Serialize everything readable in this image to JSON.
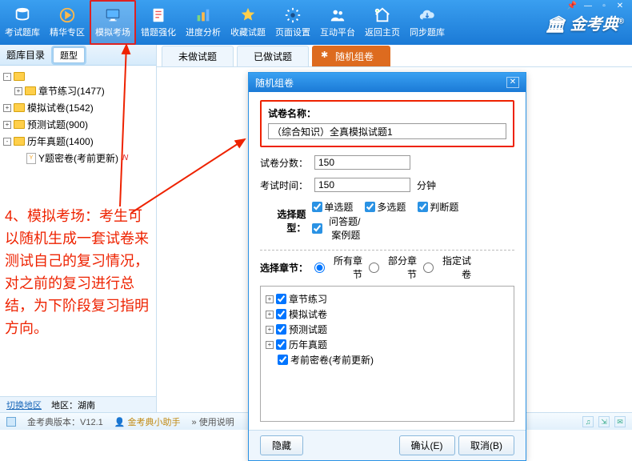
{
  "toolbar": {
    "items": [
      {
        "label": "考试题库",
        "name": "exam-bank",
        "icon": "db"
      },
      {
        "label": "精华专区",
        "name": "highlights",
        "icon": "play"
      },
      {
        "label": "模拟考场",
        "name": "mock-exam",
        "icon": "monitor",
        "selected": true
      },
      {
        "label": "错题强化",
        "name": "wrong-q",
        "icon": "sheet"
      },
      {
        "label": "进度分析",
        "name": "progress",
        "icon": "chart"
      },
      {
        "label": "收藏试题",
        "name": "favorites",
        "icon": "star"
      },
      {
        "label": "页面设置",
        "name": "page-setup",
        "icon": "gear"
      },
      {
        "label": "互动平台",
        "name": "community",
        "icon": "people"
      },
      {
        "label": "返回主页",
        "name": "home",
        "icon": "home"
      },
      {
        "label": "同步题库",
        "name": "sync",
        "icon": "cloud"
      }
    ],
    "brand": "金考典"
  },
  "win": {
    "pin": "📌",
    "min": "—",
    "max": "▫",
    "close": "✕"
  },
  "sidebar": {
    "head_label": "题库目录",
    "type_btn": "题型",
    "tree": [
      {
        "exp": "-",
        "kind": "folder",
        "label": "",
        "indent": 0
      },
      {
        "exp": "+",
        "kind": "folder",
        "label": "章节练习(1477)",
        "indent": 1
      },
      {
        "exp": "+",
        "kind": "folder",
        "label": "模拟试卷(1542)",
        "indent": 0
      },
      {
        "exp": "+",
        "kind": "folder",
        "label": "预测试题(900)",
        "indent": 0
      },
      {
        "exp": "-",
        "kind": "folder",
        "label": "历年真题(1400)",
        "indent": 0
      },
      {
        "exp": "",
        "kind": "doc",
        "label": "Y题密卷(考前更新)",
        "indent": 1,
        "isnew": true
      }
    ],
    "status_link": "切换地区",
    "status_region": "地区：湖南"
  },
  "annotation": "4、模拟考场：考生可以随机生成一套试卷来测试自己的复习情况，对之前的复习进行总结，为下阶段复习指明方向。",
  "tabs": {
    "t1": "未做试题",
    "t2": "已做试题",
    "t3": "随机组卷"
  },
  "dialog": {
    "title": "随机组卷",
    "name_label": "试卷名称：",
    "name_value": "（综合知识）全真模拟试题1",
    "score_label": "试卷分数：",
    "score_value": "150",
    "time_label": "考试时间：",
    "time_value": "150",
    "time_unit": "分钟",
    "type_label": "选择题型：",
    "types": [
      "单选题",
      "多选题",
      "判断题",
      "问答题/案例题"
    ],
    "chapter_label": "选择章节：",
    "radios": [
      "所有章节",
      "部分章节",
      "指定试卷"
    ],
    "chapters": [
      {
        "exp": "+",
        "label": "章节练习"
      },
      {
        "exp": "+",
        "label": "模拟试卷"
      },
      {
        "exp": "+",
        "label": "预测试题"
      },
      {
        "exp": "+",
        "label": "历年真题"
      },
      {
        "exp": "",
        "label": "考前密卷(考前更新)"
      }
    ],
    "btn_hide": "隐藏",
    "btn_ok": "确认(E)",
    "btn_cancel": "取消(B)"
  },
  "statusbar": {
    "version": "金考典版本：V12.1",
    "helper": "金考典小助手",
    "usage": "» 使用说明"
  }
}
